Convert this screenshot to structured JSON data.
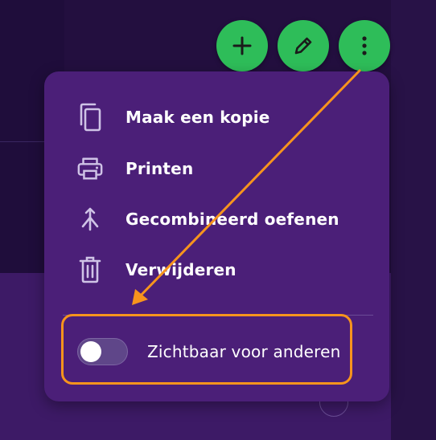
{
  "actions": {
    "add_icon": "plus-icon",
    "edit_icon": "pencil-icon",
    "more_icon": "more-vertical-icon",
    "accent_color": "#2ebd59"
  },
  "menu": {
    "items": [
      {
        "label": "Maak een kopie",
        "icon": "copy-icon"
      },
      {
        "label": "Printen",
        "icon": "printer-icon"
      },
      {
        "label": "Gecombineerd oefenen",
        "icon": "merge-icon"
      },
      {
        "label": "Verwijderen",
        "icon": "trash-icon"
      }
    ],
    "visibility": {
      "label": "Zichtbaar voor anderen",
      "enabled": false
    }
  },
  "annotation": {
    "color": "#f7941d"
  }
}
